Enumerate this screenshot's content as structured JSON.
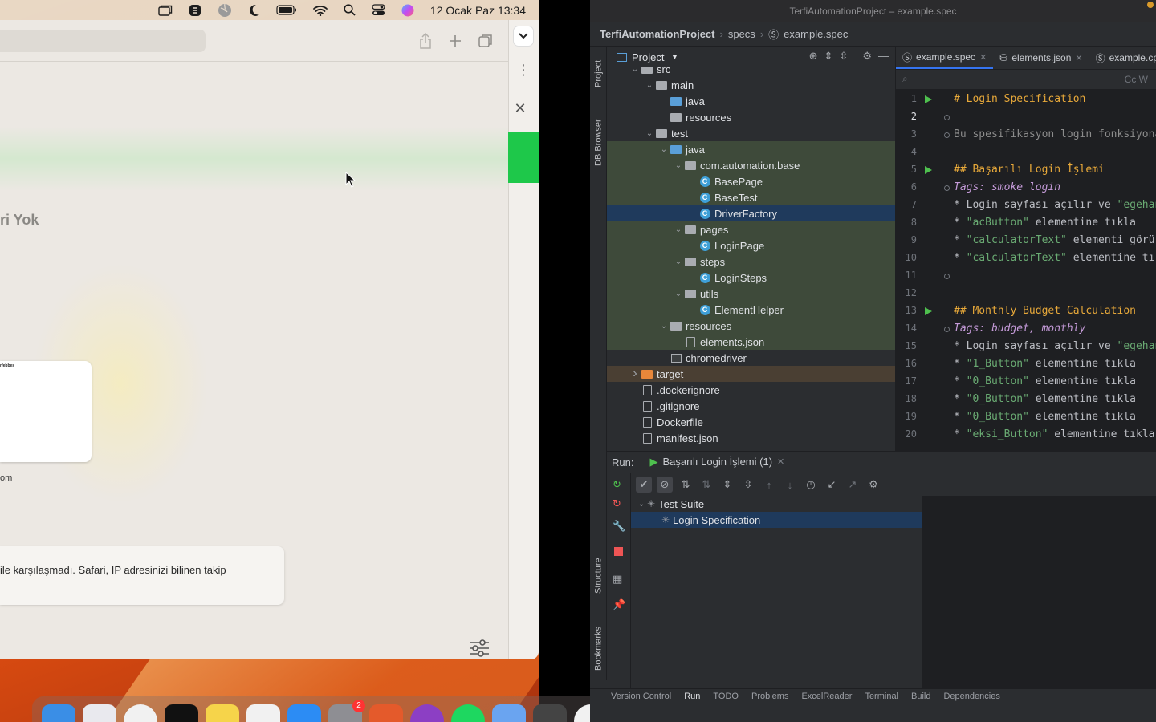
{
  "menubar": {
    "datetime": "12 Ocak Paz  13:34"
  },
  "safari": {
    "privacy_title": "ri Yok",
    "thumb_title": "rfebbes",
    "thumb_caption": "om",
    "privacy_text": "ile karşılaşmadı. Safari, IP adresinizi bilinen takip"
  },
  "ide": {
    "window_title": "TerfiAutomationProject – example.spec",
    "breadcrumb": [
      "TerfiAutomationProject",
      "specs",
      "example.spec"
    ],
    "project_label": "Project",
    "left_tabs": [
      "Project",
      "DB Browser",
      "Structure",
      "Bookmarks"
    ],
    "tree": [
      {
        "label": "src",
        "indent": 1,
        "arrow": "down",
        "icon": "folder"
      },
      {
        "label": "main",
        "indent": 2,
        "arrow": "down",
        "icon": "folder"
      },
      {
        "label": "java",
        "indent": 3,
        "arrow": "",
        "icon": "folder-blue"
      },
      {
        "label": "resources",
        "indent": 3,
        "arrow": "",
        "icon": "folder-res"
      },
      {
        "label": "test",
        "indent": 2,
        "arrow": "down",
        "icon": "folder"
      },
      {
        "label": "java",
        "indent": 3,
        "arrow": "down",
        "icon": "folder-blue"
      },
      {
        "label": "com.automation.base",
        "indent": 4,
        "arrow": "down",
        "icon": "pkg"
      },
      {
        "label": "BasePage",
        "indent": 5,
        "arrow": "",
        "icon": "class"
      },
      {
        "label": "BaseTest",
        "indent": 5,
        "arrow": "",
        "icon": "class"
      },
      {
        "label": "DriverFactory",
        "indent": 5,
        "arrow": "",
        "icon": "class"
      },
      {
        "label": "pages",
        "indent": 4,
        "arrow": "down",
        "icon": "pkg"
      },
      {
        "label": "LoginPage",
        "indent": 5,
        "arrow": "",
        "icon": "class"
      },
      {
        "label": "steps",
        "indent": 4,
        "arrow": "down",
        "icon": "pkg"
      },
      {
        "label": "LoginSteps",
        "indent": 5,
        "arrow": "",
        "icon": "class"
      },
      {
        "label": "utils",
        "indent": 4,
        "arrow": "down",
        "icon": "pkg"
      },
      {
        "label": "ElementHelper",
        "indent": 5,
        "arrow": "",
        "icon": "class"
      },
      {
        "label": "resources",
        "indent": 3,
        "arrow": "down",
        "icon": "folder-res"
      },
      {
        "label": "elements.json",
        "indent": 4,
        "arrow": "",
        "icon": "file"
      },
      {
        "label": "chromedriver",
        "indent": 3,
        "arrow": "",
        "icon": "exe"
      },
      {
        "label": "target",
        "indent": 1,
        "arrow": "right",
        "icon": "folder-orange"
      },
      {
        "label": ".dockerignore",
        "indent": 1,
        "arrow": "",
        "icon": "file"
      },
      {
        "label": ".gitignore",
        "indent": 1,
        "arrow": "",
        "icon": "file"
      },
      {
        "label": "Dockerfile",
        "indent": 1,
        "arrow": "",
        "icon": "file"
      },
      {
        "label": "manifest.json",
        "indent": 1,
        "arrow": "",
        "icon": "file"
      }
    ],
    "editor_tabs": [
      {
        "label": "example.spec",
        "active": true
      },
      {
        "label": "elements.json",
        "active": false
      },
      {
        "label": "example.cp",
        "active": false
      }
    ],
    "editor_search_icons": "Cc  W",
    "code_lines": [
      {
        "n": "1",
        "text": "# Login Specification",
        "kind": "h",
        "run": true
      },
      {
        "n": "2",
        "text": "",
        "kind": "",
        "fold": true
      },
      {
        "n": "3",
        "text": "Bu spesifikasyon login fonksiyona",
        "kind": "cm",
        "fold": true
      },
      {
        "n": "4",
        "text": "",
        "kind": ""
      },
      {
        "n": "5",
        "text": "## Başarılı Login İşlemi",
        "kind": "h",
        "run": true
      },
      {
        "n": "6",
        "text": "Tags: smoke login",
        "kind": "tag",
        "fold": true
      },
      {
        "n": "7",
        "text": "* Login sayfası açılır ve \"egehan",
        "kind": "step"
      },
      {
        "n": "8",
        "text": "* \"acButton\" elementine tıkla",
        "kind": "step"
      },
      {
        "n": "9",
        "text": "* \"calculatorText\" elementi görü",
        "kind": "step"
      },
      {
        "n": "10",
        "text": "* \"calculatorText\" elementine tı",
        "kind": "step"
      },
      {
        "n": "11",
        "text": "",
        "kind": "",
        "fold": true
      },
      {
        "n": "12",
        "text": "",
        "kind": ""
      },
      {
        "n": "13",
        "text": "## Monthly Budget Calculation",
        "kind": "h",
        "run": true
      },
      {
        "n": "14",
        "text": "Tags: budget, monthly",
        "kind": "tag",
        "fold": true
      },
      {
        "n": "15",
        "text": "* Login sayfası açılır ve \"egehan",
        "kind": "step"
      },
      {
        "n": "16",
        "text": "* \"1_Button\" elementine tıkla",
        "kind": "step"
      },
      {
        "n": "17",
        "text": "* \"0_Button\" elementine tıkla",
        "kind": "step"
      },
      {
        "n": "18",
        "text": "* \"0_Button\" elementine tıkla",
        "kind": "step"
      },
      {
        "n": "19",
        "text": "* \"0_Button\" elementine tıkla",
        "kind": "step"
      },
      {
        "n": "20",
        "text": "* \"eksi_Button\" elementine tıkla",
        "kind": "step"
      }
    ],
    "run": {
      "label": "Run:",
      "config": "Başarılı Login İşlemi (1)",
      "tree": [
        {
          "label": "Test Suite",
          "indent": 0,
          "arrow": "down",
          "selected": false
        },
        {
          "label": "Login Specification",
          "indent": 1,
          "arrow": "",
          "selected": true
        }
      ]
    },
    "status_tabs": [
      "Version Control",
      "Run",
      "TODO",
      "Problems",
      "ExcelReader",
      "Terminal",
      "Build",
      "Dependencies"
    ],
    "active_status_tab": "Run"
  },
  "dock": {
    "apps": [
      {
        "name": "finder",
        "color": "#3a8ee6"
      },
      {
        "name": "launchpad",
        "color": "#e9e9ee"
      },
      {
        "name": "chrome",
        "color": "#f1f1f1"
      },
      {
        "name": "intellij",
        "color": "#111"
      },
      {
        "name": "notes",
        "color": "#f6d44a"
      },
      {
        "name": "freeform",
        "color": "#f1f1f1"
      },
      {
        "name": "app-store",
        "color": "#2c8cf4"
      },
      {
        "name": "system-settings",
        "color": "#8e8e93",
        "badge": "2"
      },
      {
        "name": "pixelmator",
        "color": "#e45a2b"
      },
      {
        "name": "podcasts",
        "color": "#8c3fc4"
      },
      {
        "name": "spotify",
        "color": "#1ed760"
      },
      {
        "name": "preview",
        "color": "#6aa4f0"
      },
      {
        "name": "calculator",
        "color": "#444"
      },
      {
        "name": "chrome-2",
        "color": "#f1f1f1"
      },
      {
        "name": "safari",
        "color": "#2f8cf0"
      },
      {
        "name": "terminal",
        "color": "#1d1d1d"
      },
      {
        "name": "inkscape",
        "color": "#eee"
      },
      {
        "name": "folder",
        "color": "#5aa8e8"
      },
      {
        "name": "window-1",
        "color": "#ddd"
      },
      {
        "name": "window-2",
        "color": "#333"
      },
      {
        "name": "window-3",
        "color": "#eee"
      },
      {
        "name": "window-4",
        "color": "#333"
      },
      {
        "name": "window-5",
        "color": "#eee"
      },
      {
        "name": "window-6",
        "color": "#eee"
      },
      {
        "name": "window-7",
        "color": "#ddd"
      },
      {
        "name": "trash",
        "color": "#d0d3d8"
      }
    ]
  }
}
